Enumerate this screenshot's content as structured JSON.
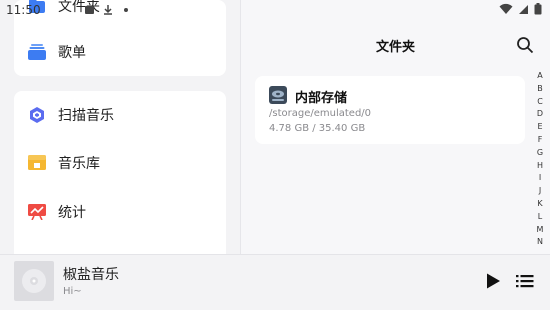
{
  "status_bar": {
    "time": "11:50"
  },
  "sidebar": {
    "card1": [
      {
        "label": "文件夹",
        "icon": "folder-icon",
        "color": "#3d7cf2"
      },
      {
        "label": "歌单",
        "icon": "playlist-icon",
        "color": "#3d7cf2"
      }
    ],
    "card2": [
      {
        "label": "扫描音乐",
        "icon": "scan-icon",
        "color": "#5b6cf0"
      },
      {
        "label": "音乐库",
        "icon": "library-icon",
        "color": "#f5b731"
      },
      {
        "label": "统计",
        "icon": "stats-icon",
        "color": "#ef4b43"
      }
    ]
  },
  "main": {
    "title": "文件夹",
    "storage": {
      "name": "内部存储",
      "path": "/storage/emulated/0",
      "size": "4.78 GB / 35.40 GB"
    },
    "alphabet": [
      "A",
      "B",
      "C",
      "D",
      "E",
      "F",
      "G",
      "H",
      "I",
      "J",
      "K",
      "L",
      "M",
      "N"
    ]
  },
  "player": {
    "title": "椒盐音乐",
    "subtitle": "Hi~"
  }
}
